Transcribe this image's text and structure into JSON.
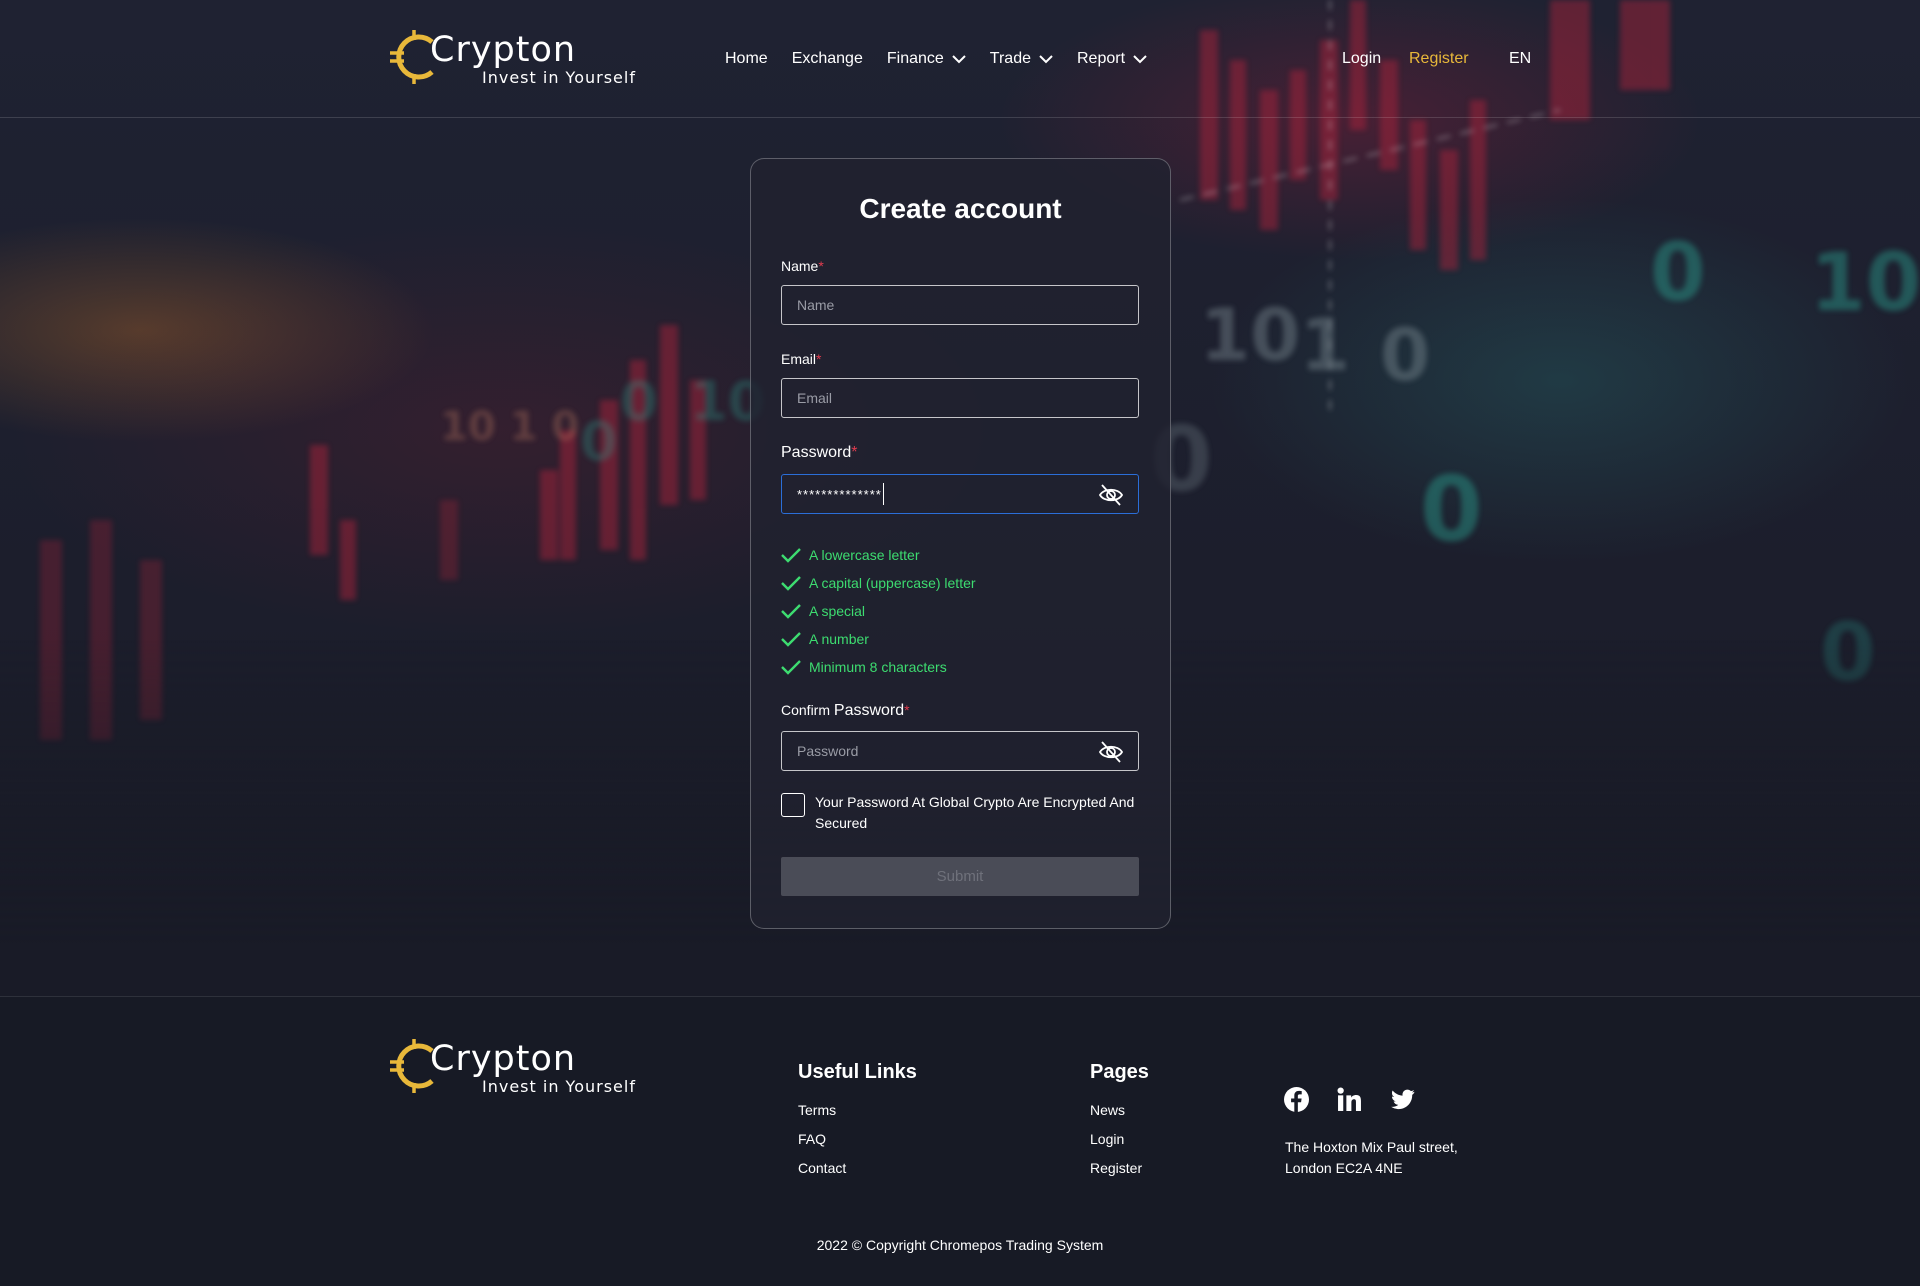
{
  "brand": {
    "name": "Crypton",
    "tagline": "Invest in Yourself",
    "accent_color": "#e8b83a"
  },
  "nav": {
    "items": [
      {
        "label": "Home",
        "dropdown": false
      },
      {
        "label": "Exchange",
        "dropdown": false
      },
      {
        "label": "Finance",
        "dropdown": true
      },
      {
        "label": "Trade",
        "dropdown": true
      },
      {
        "label": "Report",
        "dropdown": true
      }
    ],
    "login": "Login",
    "register": "Register",
    "language": "EN"
  },
  "form": {
    "title": "Create account",
    "name": {
      "label": "Name",
      "required_mark": "*",
      "placeholder": "Name",
      "value": ""
    },
    "email": {
      "label": "Email",
      "required_mark": "*",
      "placeholder": "Email",
      "value": ""
    },
    "password": {
      "label": "Password",
      "required_mark": "*",
      "masked_value": "**************",
      "toggle_icon": "eye-off-icon"
    },
    "password_rules": [
      {
        "text": "A lowercase letter",
        "met": true
      },
      {
        "text": "A capital (uppercase) letter",
        "met": true
      },
      {
        "text": "A special",
        "met": true
      },
      {
        "text": "A number",
        "met": true
      },
      {
        "text": "Minimum 8 characters",
        "met": true
      }
    ],
    "confirm_password": {
      "label_prefix": "Confirm",
      "label_main": "Password",
      "required_mark": "*",
      "placeholder": "Password",
      "value": "",
      "toggle_icon": "eye-off-icon"
    },
    "consent": {
      "text": "Your Password At Global Crypto Are Encrypted And Secured",
      "checked": false
    },
    "submit": {
      "label": "Submit",
      "enabled": false
    }
  },
  "footer": {
    "useful_links": {
      "title": "Useful Links",
      "items": [
        "Terms",
        "FAQ",
        "Contact"
      ]
    },
    "pages": {
      "title": "Pages",
      "items": [
        "News",
        "Login",
        "Register"
      ]
    },
    "social": [
      "facebook-icon",
      "linkedin-icon",
      "twitter-icon"
    ],
    "address_line1": "The Hoxton Mix Paul street,",
    "address_line2": "London EC2A 4NE",
    "copyright": "2022 © Copyright Chromepos Trading System"
  },
  "colors": {
    "page_bg": "#171a25",
    "success": "#3ddc70",
    "required": "#e23c4f",
    "focus": "#2b6ed8"
  }
}
